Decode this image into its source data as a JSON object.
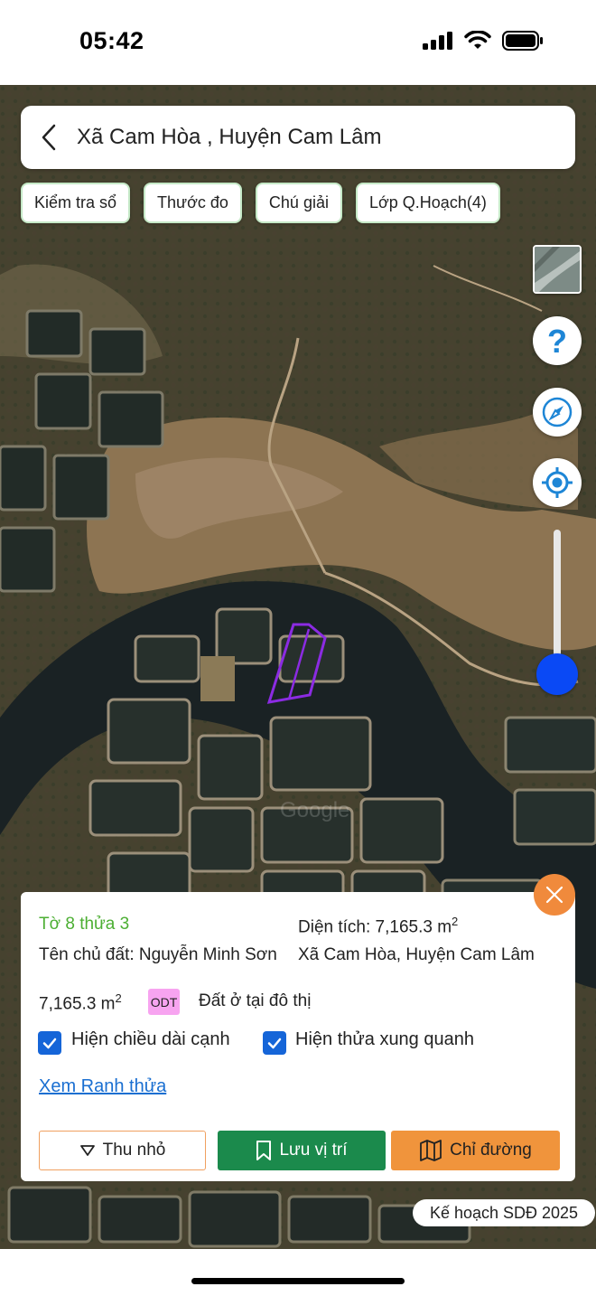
{
  "status_bar": {
    "time": "05:42",
    "icons": [
      "cellular-signal-icon",
      "wifi-icon",
      "battery-icon"
    ]
  },
  "search": {
    "title": "Xã Cam Hòa , Huyện Cam Lâm",
    "back_icon": "chevron-left-icon"
  },
  "chips": [
    {
      "label": "Kiểm tra sổ"
    },
    {
      "label": "Thước đo"
    },
    {
      "label": "Chú giải"
    },
    {
      "label": "Lớp Q.Hoạch(4)"
    }
  ],
  "map_controls": {
    "layer_icon": "satellite-layer-icon",
    "help_icon": "question-mark-icon",
    "compass_icon": "compass-icon",
    "location_icon": "my-location-icon",
    "zoom_level_fraction": 1.0
  },
  "map": {
    "watermark": "Google",
    "parcel_outline_color": "#8b2be2"
  },
  "parcel": {
    "id": "Tờ 8 thửa 3",
    "area_label": "Diện tích: 7,165.3 m",
    "area_sup": "2",
    "owner": "Tên chủ đất: Nguyễn Minh Sơn",
    "address": "Xã Cam Hòa, Huyện Cam Lâm",
    "land_area": "7,165.3 m",
    "land_area_sup": "2",
    "land_code": "ODT",
    "land_type": "Đất ở tại đô thị",
    "show_edge_length": "Hiện chiều dài cạnh",
    "show_edge_length_checked": true,
    "show_surrounding": "Hiện thửa xung quanh",
    "show_surrounding_checked": true,
    "view_boundary_link": "Xem Ranh thửa",
    "close_icon": "close-icon"
  },
  "actions": {
    "shrink": "Thu nhỏ",
    "save": "Lưu vị trí",
    "route": "Chỉ đường"
  },
  "plan_badge": "Kế hoạch SDĐ 2025",
  "colors": {
    "accent_green": "#1b8a4c",
    "accent_orange": "#f0943c",
    "link_blue": "#1a6fd1",
    "checkbox_blue": "#1565d8",
    "zoom_knob": "#0a49f5",
    "parcel_id_green": "#4caf33",
    "odt_badge": "#f7a4f0"
  }
}
